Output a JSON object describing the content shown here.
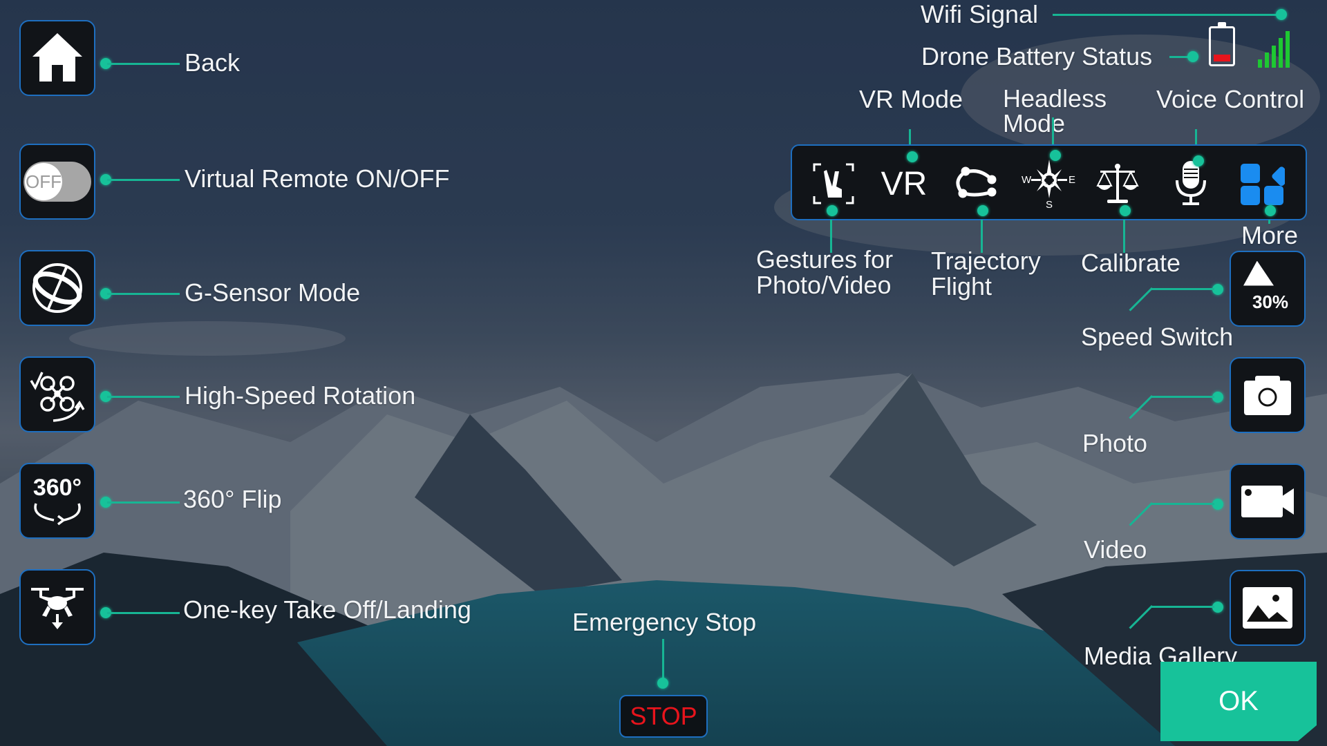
{
  "left_controls": [
    {
      "id": "back",
      "label": "Back",
      "icon": "home-icon"
    },
    {
      "id": "virtual-remote",
      "label": "Virtual Remote ON/OFF",
      "icon": "toggle-icon",
      "toggle_state": "OFF"
    },
    {
      "id": "g-sensor",
      "label": "G-Sensor Mode",
      "icon": "gyro-icon"
    },
    {
      "id": "high-speed-rotation",
      "label": "High-Speed Rotation",
      "icon": "drone-rotate-icon"
    },
    {
      "id": "flip",
      "label": "360° Flip",
      "icon": "flip-360-icon",
      "icon_text": "360°"
    },
    {
      "id": "takeoff",
      "label": "One-key Take Off/Landing",
      "icon": "drone-landing-icon"
    }
  ],
  "status": {
    "wifi_label": "Wifi Signal",
    "battery_label": "Drone Battery Status",
    "battery_level": 0.2,
    "wifi_bars": 5,
    "battery_color": "#e8141c",
    "wifi_color": "#1ec832"
  },
  "toolbar": {
    "items": [
      {
        "id": "gestures",
        "icon": "gesture-hand-icon",
        "label": "Gestures for Photo/Video",
        "label_lines": [
          "Gestures for",
          "Photo/Video"
        ]
      },
      {
        "id": "vr",
        "icon": "vr-icon",
        "icon_text": "VR",
        "label": "VR Mode"
      },
      {
        "id": "trajectory",
        "icon": "trajectory-icon",
        "label": "Trajectory Flight",
        "label_lines": [
          "Trajectory",
          "Flight"
        ]
      },
      {
        "id": "headless",
        "icon": "compass-icon",
        "label": "Headless Mode",
        "label_lines": [
          "Headless",
          "Mode"
        ],
        "compass": [
          "W",
          "E",
          "S"
        ]
      },
      {
        "id": "calibrate",
        "icon": "scales-icon",
        "label": "Calibrate"
      },
      {
        "id": "voice",
        "icon": "microphone-icon",
        "label": "Voice Control"
      },
      {
        "id": "more",
        "icon": "apps-grid-icon",
        "label": "More"
      }
    ]
  },
  "right_controls": [
    {
      "id": "speed",
      "label": "Speed Switch",
      "icon": "speed-icon",
      "value": "30%"
    },
    {
      "id": "photo",
      "label": "Photo",
      "icon": "camera-icon"
    },
    {
      "id": "video",
      "label": "Video",
      "icon": "video-camera-icon"
    },
    {
      "id": "gallery",
      "label": "Media Gallery",
      "icon": "image-gallery-icon"
    }
  ],
  "emergency": {
    "label": "Emergency Stop",
    "button": "STOP"
  },
  "ok_button": "OK",
  "colors": {
    "accent": "#17c29a",
    "border": "#1e6fc0",
    "stop": "#e8141c",
    "more": "#1a8cf0"
  }
}
